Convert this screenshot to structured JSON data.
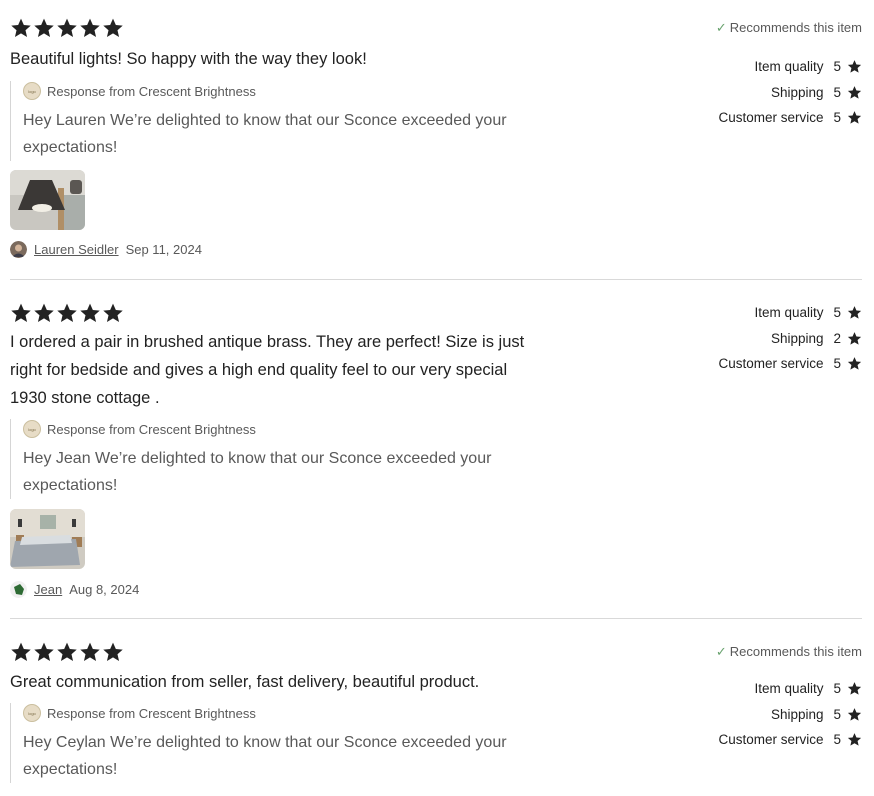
{
  "reviews": [
    {
      "rating": 5,
      "text": "Beautiful lights! So happy with the way they look!",
      "recommends": "Recommends this item",
      "ratings": [
        {
          "label": "Item quality",
          "value": "5"
        },
        {
          "label": "Shipping",
          "value": "5"
        },
        {
          "label": "Customer service",
          "value": "5"
        }
      ],
      "response_from": "Response from Crescent Brightness",
      "response_text": "Hey Lauren We’re delighted to know that our Sconce exceeded your expectations!",
      "reviewer": "Lauren Seidler",
      "date": "Sep 11, 2024"
    },
    {
      "rating": 5,
      "text": "I ordered a pair in brushed antique brass. They are perfect! Size is just right for bedside and gives a high end quality feel to our very special 1930 stone cottage .",
      "recommends": "",
      "ratings": [
        {
          "label": "Item quality",
          "value": "5"
        },
        {
          "label": "Shipping",
          "value": "2"
        },
        {
          "label": "Customer service",
          "value": "5"
        }
      ],
      "response_from": "Response from Crescent Brightness",
      "response_text": "Hey Jean We’re delighted to know that our Sconce exceeded your expectations!",
      "reviewer": "Jean",
      "date": "Aug 8, 2024"
    },
    {
      "rating": 5,
      "text": "Great communication from seller, fast delivery, beautiful product.",
      "recommends": "Recommends this item",
      "ratings": [
        {
          "label": "Item quality",
          "value": "5"
        },
        {
          "label": "Shipping",
          "value": "5"
        },
        {
          "label": "Customer service",
          "value": "5"
        }
      ],
      "response_from": "Response from Crescent Brightness",
      "response_text": "Hey Ceylan We’re delighted to know that our Sconce exceeded your expectations!",
      "reviewer": "",
      "date": ""
    }
  ],
  "colors": {
    "star": "#222222",
    "check": "#6aa36f",
    "muted": "#595959"
  },
  "icons": {
    "star": "star-icon",
    "check": "checkmark-icon",
    "shop_logo": "shop-logo-icon"
  }
}
